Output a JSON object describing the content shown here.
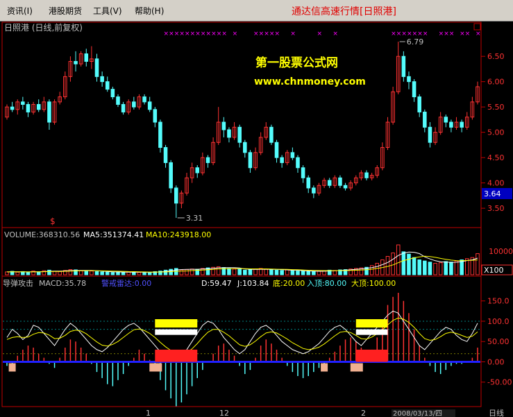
{
  "menu": {
    "items": [
      "资讯(I)",
      "港股期货",
      "工具(V)",
      "帮助(H)"
    ],
    "banner": "通达信高速行情[日照港]"
  },
  "price_pane": {
    "title": "日照港 (日线,前复权)",
    "watermark_line1": "第一股票公式网",
    "watermark_line2": "www.chnmoney.com",
    "high_label": "6.79",
    "low_label": "3.31",
    "current_price": "3.64",
    "signal_mark": "$",
    "axis_ticks": [
      "6.50",
      "6.00",
      "5.50",
      "5.00",
      "4.50",
      "4.00",
      "3.50"
    ]
  },
  "volume_pane": {
    "label": "VOLUME:368310.56",
    "ma5": "MA5:351374.41",
    "ma10": "MA10:243918.00",
    "axis_tick": "10000",
    "axis_unit": "X100"
  },
  "indicator_pane": {
    "label": "导弹攻击",
    "macd": "MACD:35.78",
    "warning": "警戒雷达:0.00",
    "d": "D:59.47",
    "j": "J:103.84",
    "bottom": "底:20.00",
    "enter_top": "入顶:80.00",
    "big_top": "大顶:100.00",
    "axis_ticks": [
      "150.0",
      "100.0",
      "50.00",
      "0.00",
      "-50.00"
    ]
  },
  "x_axis": {
    "labels": [
      "1",
      "12",
      "2"
    ],
    "date_text": "2008/03/13/四",
    "corner": "日线"
  },
  "colors": {
    "up": "#ff3232",
    "down": "#54fcfc",
    "ma5": "#ffffff",
    "ma10": "#ffff00",
    "axis": "#c00000",
    "marker": "#ff00ff"
  },
  "chart_data": {
    "type": "candlestick",
    "title": "日照港 (日线,前复权)",
    "ylim": [
      3.2,
      6.9
    ],
    "high": 6.79,
    "low": 3.31,
    "last": 3.64,
    "candles": [
      [
        5.3,
        5.5,
        5.25,
        5.55
      ],
      [
        5.5,
        5.45,
        5.4,
        5.6
      ],
      [
        5.45,
        5.6,
        5.35,
        5.65
      ],
      [
        5.6,
        5.55,
        5.45,
        5.7
      ],
      [
        5.55,
        5.4,
        5.3,
        5.6
      ],
      [
        5.4,
        5.55,
        5.35,
        5.6
      ],
      [
        5.55,
        5.45,
        5.4,
        5.65
      ],
      [
        5.45,
        5.6,
        5.4,
        5.7
      ],
      [
        5.6,
        5.2,
        5.05,
        5.65
      ],
      [
        5.2,
        5.6,
        5.15,
        5.65
      ],
      [
        5.6,
        5.7,
        5.55,
        5.8
      ],
      [
        5.7,
        6.1,
        5.65,
        6.2
      ],
      [
        6.1,
        6.4,
        6.0,
        6.5
      ],
      [
        6.4,
        6.35,
        6.2,
        6.6
      ],
      [
        6.35,
        6.55,
        6.3,
        6.6
      ],
      [
        6.55,
        6.4,
        6.3,
        6.65
      ],
      [
        6.4,
        6.45,
        6.25,
        6.7
      ],
      [
        6.45,
        6.1,
        6.0,
        6.55
      ],
      [
        6.1,
        6.0,
        5.9,
        6.2
      ],
      [
        6.0,
        5.85,
        5.8,
        6.1
      ],
      [
        5.85,
        5.7,
        5.65,
        5.9
      ],
      [
        5.7,
        5.55,
        5.5,
        5.75
      ],
      [
        5.55,
        5.4,
        5.35,
        5.6
      ],
      [
        5.4,
        5.6,
        5.35,
        5.65
      ],
      [
        5.6,
        5.5,
        5.45,
        5.7
      ],
      [
        5.5,
        5.7,
        5.45,
        5.75
      ],
      [
        5.7,
        5.6,
        5.55,
        5.75
      ],
      [
        5.6,
        5.45,
        5.4,
        5.7
      ],
      [
        5.45,
        5.2,
        5.1,
        5.5
      ],
      [
        5.2,
        4.7,
        4.6,
        5.25
      ],
      [
        4.7,
        4.4,
        4.3,
        4.75
      ],
      [
        4.4,
        3.9,
        3.8,
        4.45
      ],
      [
        3.9,
        3.6,
        3.31,
        3.95
      ],
      [
        3.6,
        3.8,
        3.5,
        3.85
      ],
      [
        3.8,
        4.1,
        3.75,
        4.2
      ],
      [
        4.1,
        4.3,
        4.0,
        4.4
      ],
      [
        4.3,
        4.2,
        4.1,
        4.35
      ],
      [
        4.2,
        4.5,
        4.15,
        4.6
      ],
      [
        4.5,
        4.4,
        4.3,
        4.55
      ],
      [
        4.4,
        4.8,
        4.35,
        4.9
      ],
      [
        4.8,
        5.2,
        4.75,
        5.5
      ],
      [
        5.2,
        5.05,
        4.9,
        5.3
      ],
      [
        5.05,
        4.9,
        4.8,
        5.1
      ],
      [
        4.9,
        5.1,
        4.85,
        5.2
      ],
      [
        5.1,
        4.8,
        4.7,
        5.15
      ],
      [
        4.8,
        4.6,
        4.5,
        4.85
      ],
      [
        4.6,
        4.3,
        4.2,
        4.65
      ],
      [
        4.3,
        4.6,
        4.25,
        4.7
      ],
      [
        4.6,
        4.9,
        4.55,
        5.0
      ],
      [
        4.9,
        5.1,
        4.85,
        5.2
      ],
      [
        5.1,
        4.8,
        4.75,
        5.15
      ],
      [
        4.8,
        4.5,
        4.4,
        4.85
      ],
      [
        4.5,
        4.4,
        4.3,
        4.55
      ],
      [
        4.4,
        4.6,
        4.35,
        4.65
      ],
      [
        4.6,
        4.5,
        4.45,
        4.7
      ],
      [
        4.5,
        4.3,
        4.2,
        4.55
      ],
      [
        4.3,
        4.1,
        4.0,
        4.35
      ],
      [
        4.1,
        3.9,
        3.8,
        4.15
      ],
      [
        3.9,
        3.8,
        3.7,
        3.95
      ],
      [
        3.8,
        3.95,
        3.75,
        4.0
      ],
      [
        3.95,
        4.05,
        3.9,
        4.1
      ],
      [
        4.05,
        3.95,
        3.9,
        4.1
      ],
      [
        3.95,
        4.1,
        3.9,
        4.15
      ],
      [
        4.1,
        3.95,
        3.9,
        4.15
      ],
      [
        3.95,
        3.9,
        3.85,
        4.0
      ],
      [
        3.9,
        4.0,
        3.85,
        4.05
      ],
      [
        4.0,
        4.1,
        3.95,
        4.15
      ],
      [
        4.1,
        4.2,
        4.05,
        4.25
      ],
      [
        4.2,
        4.1,
        4.05,
        4.25
      ],
      [
        4.1,
        4.15,
        4.05,
        4.2
      ],
      [
        4.15,
        4.3,
        4.1,
        4.35
      ],
      [
        4.3,
        4.7,
        4.25,
        4.8
      ],
      [
        4.7,
        5.2,
        4.65,
        5.3
      ],
      [
        5.2,
        5.8,
        5.15,
        5.9
      ],
      [
        5.8,
        6.5,
        5.75,
        6.79
      ],
      [
        6.5,
        6.1,
        6.0,
        6.6
      ],
      [
        6.1,
        6.0,
        5.85,
        6.2
      ],
      [
        6.0,
        5.7,
        5.6,
        6.05
      ],
      [
        5.7,
        5.4,
        5.3,
        5.75
      ],
      [
        5.4,
        5.1,
        5.0,
        5.45
      ],
      [
        5.1,
        4.8,
        4.7,
        5.2
      ],
      [
        4.8,
        5.0,
        4.75,
        5.1
      ],
      [
        5.0,
        5.3,
        4.95,
        5.4
      ],
      [
        5.3,
        5.2,
        5.1,
        5.35
      ],
      [
        5.2,
        5.1,
        5.0,
        5.25
      ],
      [
        5.1,
        5.2,
        5.05,
        5.3
      ],
      [
        5.2,
        5.1,
        5.0,
        5.25
      ],
      [
        5.1,
        5.3,
        5.05,
        5.4
      ],
      [
        5.3,
        5.6,
        5.25,
        5.7
      ],
      [
        5.6,
        5.9,
        5.55,
        6.0
      ]
    ],
    "volume": [
      50,
      60,
      45,
      55,
      40,
      65,
      50,
      70,
      80,
      60,
      55,
      75,
      90,
      85,
      70,
      60,
      65,
      55,
      50,
      45,
      40,
      48,
      42,
      50,
      45,
      40,
      38,
      42,
      55,
      65,
      80,
      95,
      110,
      85,
      90,
      100,
      95,
      110,
      120,
      130,
      140,
      125,
      110,
      100,
      95,
      80,
      90,
      100,
      110,
      95,
      85,
      80,
      75,
      85,
      70,
      65,
      60,
      55,
      60,
      65,
      70,
      80,
      75,
      85,
      90,
      100,
      110,
      120,
      130,
      160,
      200,
      260,
      320,
      380,
      520,
      400,
      360,
      300,
      260,
      240,
      220,
      200,
      210,
      230,
      220,
      240,
      260,
      280,
      300,
      368
    ],
    "vol_ma5": [
      50,
      53,
      51,
      52,
      50,
      53,
      51,
      55,
      61,
      64,
      63,
      68,
      72,
      74,
      76,
      76,
      75,
      71,
      64,
      57,
      52,
      50,
      47,
      46,
      45,
      45,
      43,
      43,
      44,
      49,
      58,
      69,
      83,
      91,
      94,
      96,
      96,
      100,
      104,
      112,
      121,
      125,
      125,
      125,
      118,
      102,
      96,
      93,
      95,
      96,
      94,
      94,
      89,
      84,
      79,
      77,
      71,
      67,
      63,
      61,
      62,
      66,
      69,
      75,
      80,
      86,
      94,
      103,
      114,
      124,
      144,
      176,
      214,
      270,
      336,
      376,
      396,
      392,
      368,
      312,
      276,
      244,
      226,
      220,
      216,
      218,
      230,
      246,
      260,
      290
    ],
    "vol_ma10": [
      50,
      52,
      51,
      52,
      50,
      52,
      51,
      53,
      56,
      57,
      58,
      60,
      64,
      67,
      69,
      70,
      71,
      70,
      68,
      67,
      64,
      62,
      59,
      56,
      54,
      52,
      49,
      47,
      47,
      48,
      50,
      54,
      59,
      63,
      67,
      72,
      77,
      82,
      88,
      94,
      101,
      104,
      106,
      107,
      108,
      105,
      103,
      103,
      103,
      103,
      100,
      97,
      95,
      93,
      90,
      87,
      83,
      79,
      76,
      74,
      73,
      72,
      71,
      72,
      73,
      75,
      78,
      83,
      88,
      97,
      110,
      126,
      146,
      171,
      210,
      246,
      271,
      296,
      311,
      323,
      317,
      303,
      285,
      269,
      255,
      247,
      245,
      249,
      252,
      259
    ],
    "kd_k": [
      60,
      80,
      70,
      55,
      65,
      90,
      85,
      70,
      55,
      40,
      60,
      80,
      95,
      85,
      70,
      55,
      40,
      30,
      25,
      35,
      50,
      65,
      80,
      90,
      95,
      85,
      70,
      55,
      40,
      25,
      15,
      10,
      8,
      15,
      30,
      50,
      70,
      90,
      100,
      95,
      80,
      60,
      45,
      30,
      20,
      30,
      50,
      70,
      85,
      90,
      80,
      65,
      50,
      40,
      30,
      25,
      20,
      25,
      35,
      45,
      60,
      75,
      85,
      90,
      80,
      65,
      50,
      40,
      55,
      70,
      85,
      100,
      115,
      125,
      120,
      100,
      80,
      60,
      40,
      30,
      45,
      60,
      75,
      85,
      80,
      65,
      55,
      50,
      70,
      95
    ],
    "kd_d": [
      55,
      60,
      62,
      60,
      61,
      68,
      72,
      71,
      66,
      57,
      58,
      65,
      75,
      78,
      76,
      69,
      59,
      49,
      41,
      39,
      43,
      50,
      60,
      70,
      79,
      81,
      77,
      70,
      60,
      48,
      37,
      28,
      21,
      19,
      23,
      32,
      45,
      60,
      73,
      80,
      80,
      73,
      64,
      53,
      42,
      38,
      42,
      51,
      62,
      71,
      74,
      71,
      64,
      56,
      47,
      40,
      33,
      30,
      32,
      36,
      44,
      54,
      64,
      73,
      75,
      72,
      65,
      57,
      56,
      61,
      69,
      79,
      91,
      102,
      108,
      105,
      97,
      85,
      70,
      57,
      53,
      55,
      62,
      70,
      73,
      70,
      65,
      60,
      63,
      74
    ],
    "macd_bar": [
      -10,
      -8,
      15,
      30,
      40,
      35,
      20,
      10,
      -5,
      -15,
      10,
      35,
      55,
      50,
      35,
      20,
      -5,
      -25,
      -40,
      -55,
      -60,
      -45,
      -30,
      -10,
      10,
      30,
      20,
      5,
      -20,
      -45,
      -70,
      -90,
      -110,
      -100,
      -80,
      -60,
      -40,
      -20,
      0,
      20,
      40,
      45,
      30,
      15,
      -10,
      -30,
      -20,
      10,
      40,
      55,
      45,
      30,
      10,
      -10,
      -25,
      -35,
      -40,
      -35,
      -25,
      -15,
      -5,
      10,
      25,
      40,
      55,
      60,
      50,
      35,
      20,
      30,
      60,
      100,
      140,
      160,
      170,
      150,
      120,
      80,
      40,
      10,
      -10,
      -25,
      -30,
      -20,
      -10,
      -5,
      -5,
      0,
      10,
      35
    ],
    "ylim_indicator": [
      -100,
      170
    ]
  }
}
